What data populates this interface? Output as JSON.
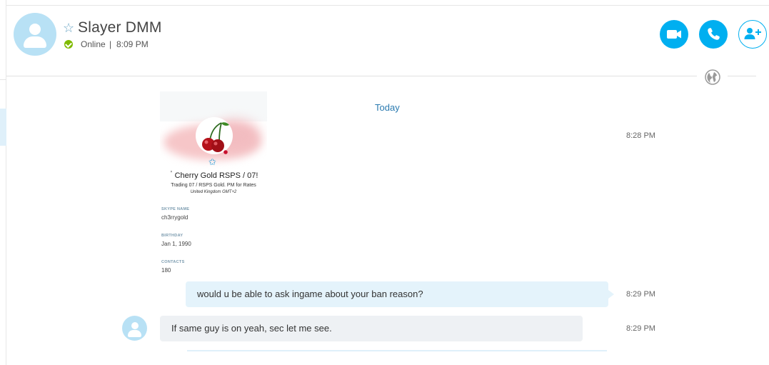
{
  "header": {
    "contact_name": "Slayer DMM",
    "status": "Online",
    "separator": "|",
    "status_time": "8:09 PM"
  },
  "conversation": {
    "day_label": "Today",
    "profile_card": {
      "timestamp": "8:28 PM",
      "display_name": "Cherry Gold RSPS / 07!",
      "quote_mark": "'",
      "mood": "Trading 07 / RSPS Gold. PM for Rates",
      "location": "United Kingdom GMT+2",
      "fields": [
        {
          "label": "SKYPE NAME",
          "value": "ch3rrygold"
        },
        {
          "label": "BIRTHDAY",
          "value": "Jan 1, 1990"
        },
        {
          "label": "CONTACTS",
          "value": "180"
        }
      ]
    },
    "messages": [
      {
        "direction": "outgoing",
        "text": "would u be able to ask ingame about your ban reason?",
        "time": "8:29 PM"
      },
      {
        "direction": "incoming",
        "text": "If same guy is on yeah, sec let me see.",
        "time": "8:29 PM"
      }
    ]
  },
  "icons": {
    "favorite": "star-icon",
    "presence": "online-check-icon",
    "video_call": "video-camera-icon",
    "audio_call": "phone-icon",
    "add_people": "add-person-icon",
    "translator": "globe-icon"
  },
  "colors": {
    "accent": "#00aff0",
    "online": "#7fba00",
    "avatar_bg": "#b8e1f5",
    "outgoing_bubble": "#e4f3fb",
    "incoming_bubble": "#eef1f4",
    "day_label": "#2a7ab0"
  }
}
